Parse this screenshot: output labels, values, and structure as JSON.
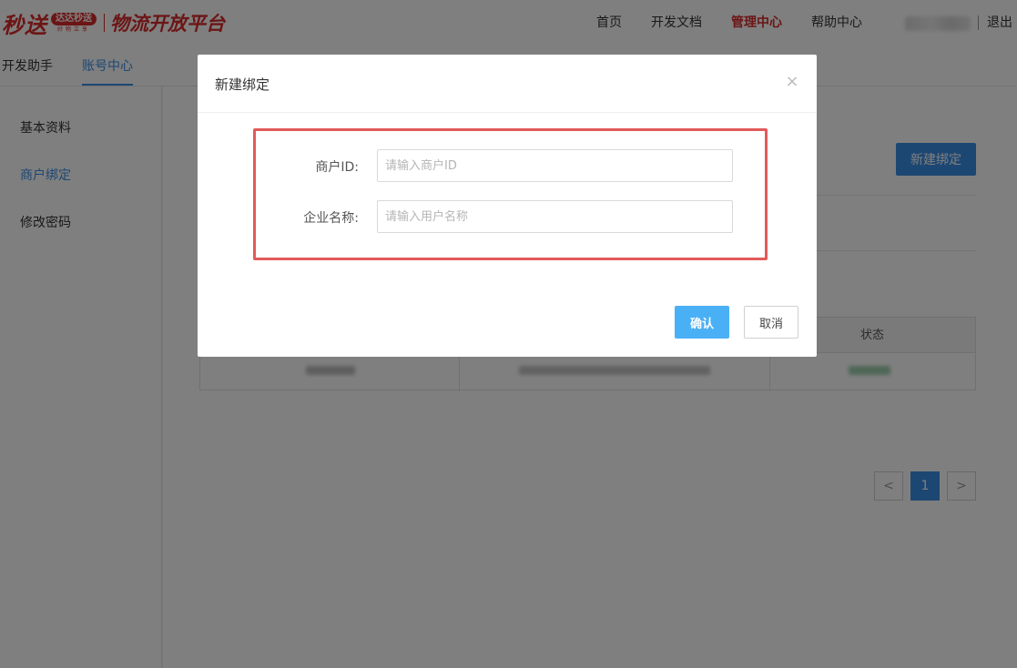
{
  "header": {
    "logo": {
      "main": "秒送",
      "badge": "达达秒送",
      "badge_sub": "好物立享",
      "platform": "物流开放平台"
    },
    "nav": [
      {
        "label": "首页"
      },
      {
        "label": "开发文档"
      },
      {
        "label": "管理中心",
        "active": true
      },
      {
        "label": "帮助中心"
      }
    ],
    "logout_label": "退出"
  },
  "subnav": {
    "items": [
      {
        "label": "开发助手"
      },
      {
        "label": "账号中心",
        "active": true
      }
    ]
  },
  "sidebar": {
    "items": [
      {
        "label": "基本资料"
      },
      {
        "label": "商户绑定",
        "active": true
      },
      {
        "label": "修改密码"
      }
    ]
  },
  "content": {
    "new_bind_label": "新建绑定",
    "table": {
      "columns": [
        "状态"
      ]
    },
    "pagination": {
      "prev": "<",
      "current": "1",
      "next": ">"
    }
  },
  "modal": {
    "title": "新建绑定",
    "close_glyph": "×",
    "fields": [
      {
        "label": "商户ID:",
        "placeholder": "请输入商户ID",
        "value": ""
      },
      {
        "label": "企业名称:",
        "placeholder": "请输入用户名称",
        "value": ""
      }
    ],
    "confirm_label": "确认",
    "cancel_label": "取消"
  },
  "colors": {
    "brand_red": "#d92b2b",
    "accent_blue": "#3a8ee6",
    "confirm_blue": "#4ab0f5",
    "highlight_red": "#e35a5a"
  }
}
